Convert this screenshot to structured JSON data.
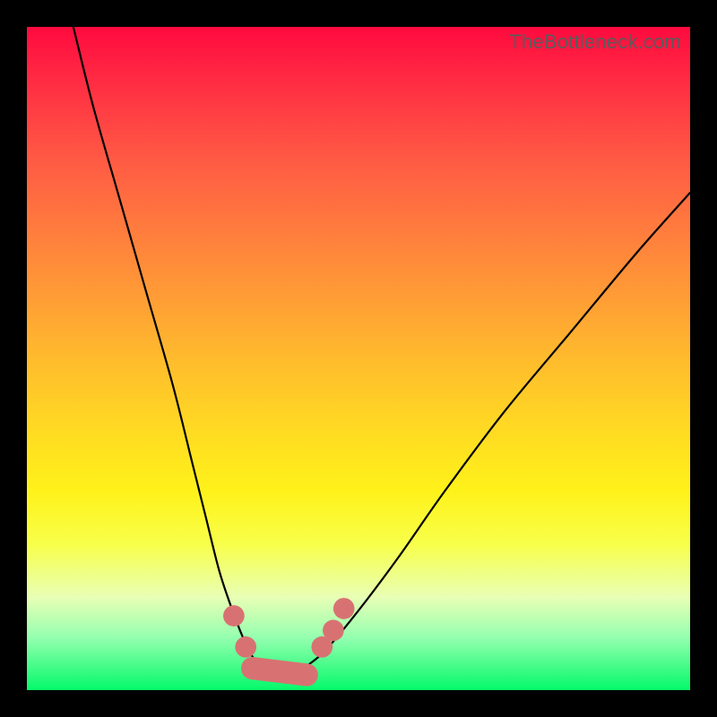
{
  "watermark": "TheBottleneck.com",
  "colors": {
    "frame": "#000000",
    "curve": "#000000",
    "marker": "#d87272",
    "gradient_top": "#ff0a3e",
    "gradient_bottom": "#04f96a"
  },
  "chart_data": {
    "type": "line",
    "title": "",
    "xlabel": "",
    "ylabel": "",
    "xlim": [
      0,
      100
    ],
    "ylim": [
      0,
      100
    ],
    "series": [
      {
        "name": "bottleneck-curve",
        "x": [
          7,
          10,
          14,
          18,
          22,
          25,
          27,
          29,
          31,
          33,
          35,
          36.5,
          38,
          40,
          42,
          45,
          50,
          56,
          63,
          72,
          82,
          92,
          100
        ],
        "y": [
          100,
          88,
          74,
          60,
          46,
          34,
          26,
          18,
          12,
          7,
          3.5,
          2.2,
          2.0,
          2.2,
          3.5,
          6,
          12,
          20,
          30,
          42,
          54,
          66,
          75
        ]
      }
    ],
    "markers": [
      {
        "shape": "circle",
        "x": 31.2,
        "y": 11.2,
        "r": 1.6
      },
      {
        "shape": "circle",
        "x": 33.0,
        "y": 6.5,
        "r": 1.6
      },
      {
        "shape": "circle",
        "x": 44.5,
        "y": 6.5,
        "r": 1.6
      },
      {
        "shape": "circle",
        "x": 46.2,
        "y": 9.0,
        "r": 1.6
      },
      {
        "shape": "circle",
        "x": 47.8,
        "y": 12.3,
        "r": 1.6
      },
      {
        "shape": "pill",
        "x1": 34.0,
        "y1": 3.3,
        "x2": 42.2,
        "y2": 2.3,
        "w": 3.4
      }
    ],
    "annotations": []
  }
}
